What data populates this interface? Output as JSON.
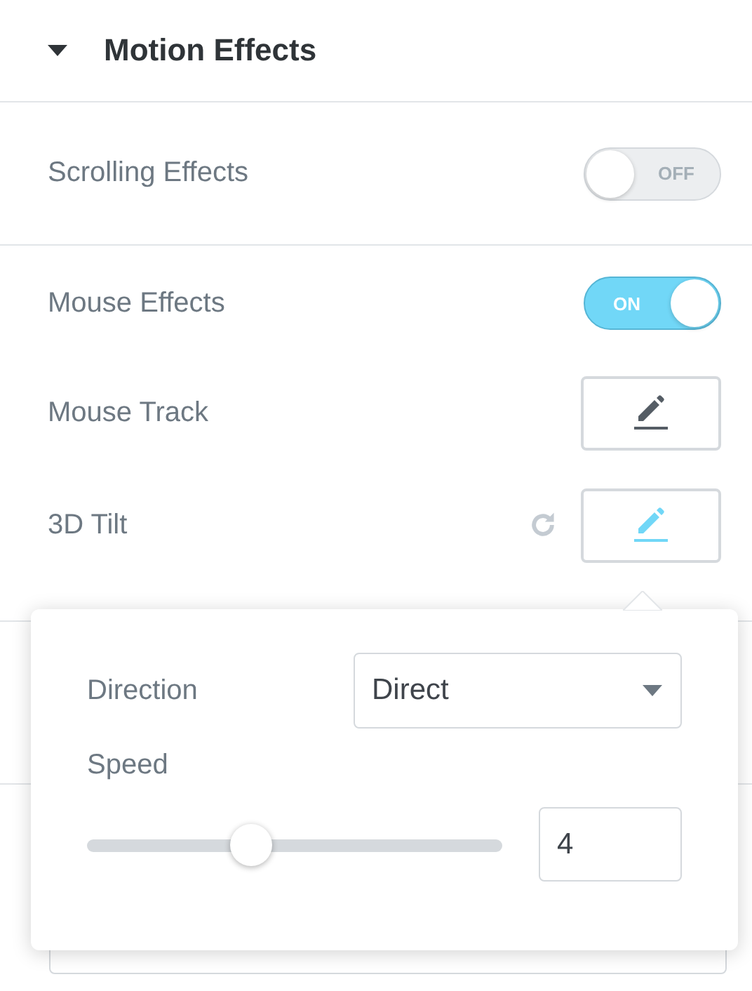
{
  "section": {
    "title": "Motion Effects",
    "expanded": true
  },
  "groups": [
    {
      "rows": [
        {
          "kind": "switch",
          "label": "Scrolling Effects",
          "on": false,
          "text": "OFF"
        }
      ]
    },
    {
      "rows": [
        {
          "kind": "switch",
          "label": "Mouse Effects",
          "on": true,
          "text": "ON"
        },
        {
          "kind": "edit",
          "label": "Mouse Track",
          "active": false,
          "resettable": false
        },
        {
          "kind": "edit",
          "label": "3D Tilt",
          "active": true,
          "resettable": true
        }
      ]
    }
  ],
  "popover": {
    "direction": {
      "label": "Direction",
      "value": "Direct"
    },
    "speed": {
      "label": "Speed",
      "level": 0.395,
      "value": "4"
    }
  }
}
